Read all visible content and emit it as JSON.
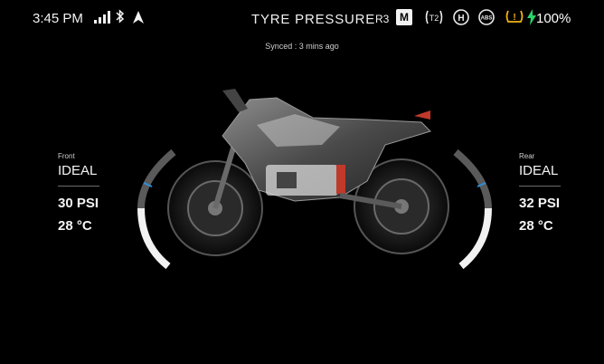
{
  "status_bar": {
    "time": "3:45 PM",
    "title": "TYRE PRESSURE",
    "ride_mode": "R3",
    "m_label": "M",
    "t2_label": "T2",
    "h_label": "H",
    "abs_label": "ABS",
    "warning_label": "!",
    "battery": "100%"
  },
  "synced_text": "Synced : 3 mins ago",
  "front": {
    "label": "Front",
    "status": "IDEAL",
    "pressure": "30 PSI",
    "temperature": "28 °C"
  },
  "rear": {
    "label": "Rear",
    "status": "IDEAL",
    "pressure": "32 PSI",
    "temperature": "28 °C"
  },
  "colors": {
    "accent": "#2f8fd6",
    "warning": "#f2b215",
    "battery": "#2bd46a",
    "gauge_fill": "#f2f2f2",
    "gauge_track": "#5a5a5a"
  },
  "icons": [
    "signal-icon",
    "bluetooth-icon",
    "navigation-icon",
    "tpms-icon",
    "hold-icon",
    "abs-icon",
    "tyre-warning-icon",
    "charging-bolt-icon",
    "motorcycle-image"
  ]
}
